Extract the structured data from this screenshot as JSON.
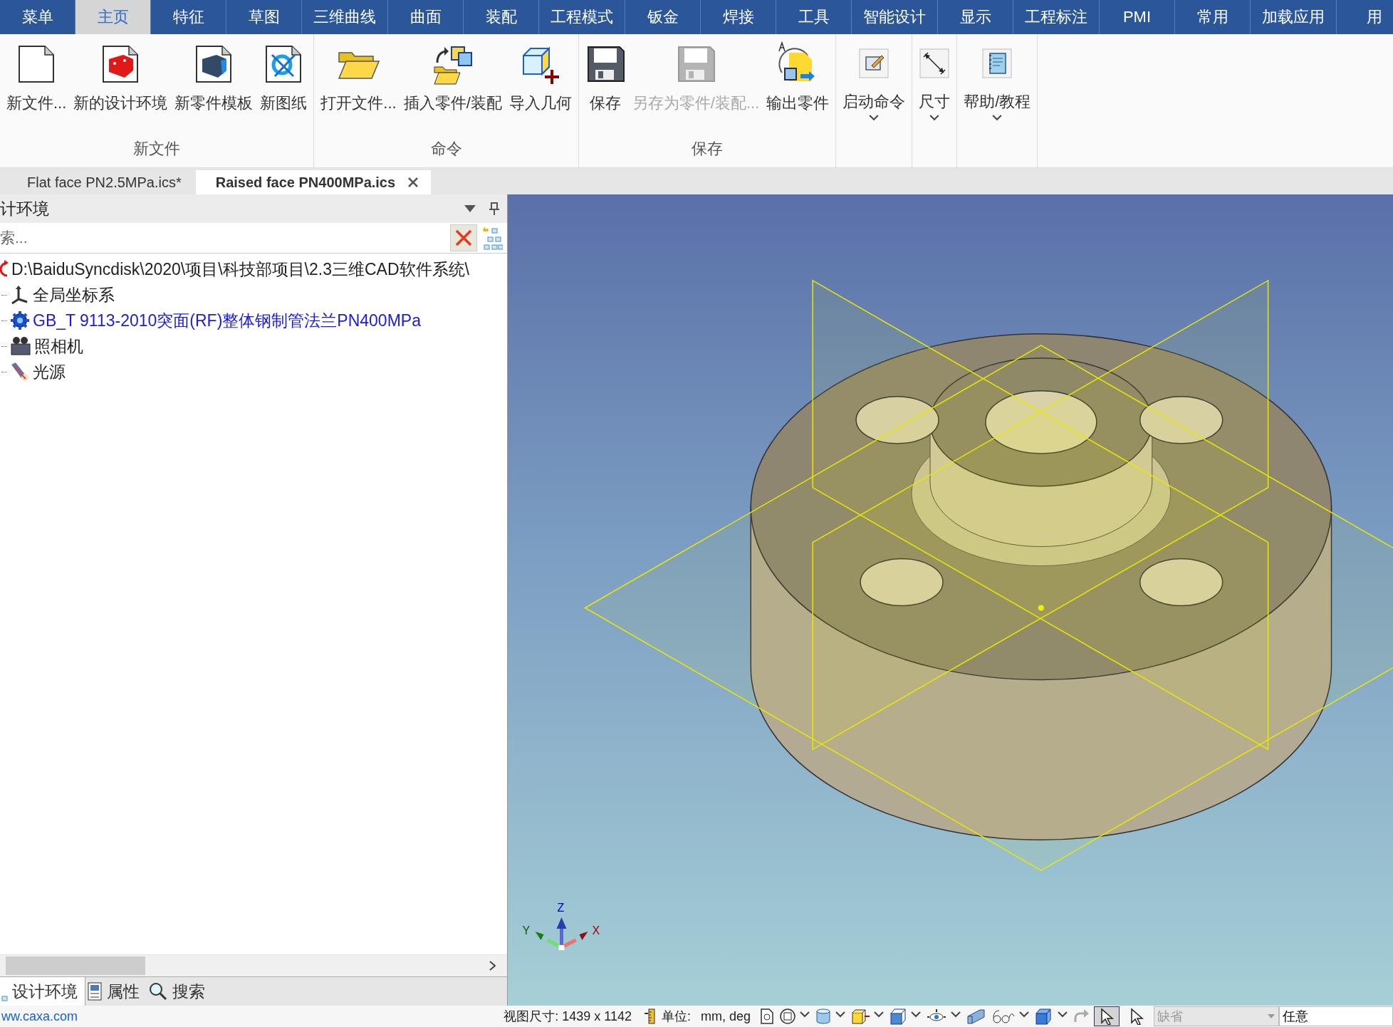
{
  "menu_tabs": [
    {
      "label": "菜单",
      "selected": false
    },
    {
      "label": "主页",
      "selected": true
    },
    {
      "label": "特征",
      "selected": false
    },
    {
      "label": "草图",
      "selected": false
    },
    {
      "label": "三维曲线",
      "selected": false
    },
    {
      "label": "曲面",
      "selected": false
    },
    {
      "label": "装配",
      "selected": false
    },
    {
      "label": "工程模式",
      "selected": false
    },
    {
      "label": "钣金",
      "selected": false
    },
    {
      "label": "焊接",
      "selected": false
    },
    {
      "label": "工具",
      "selected": false
    },
    {
      "label": "智能设计",
      "selected": false
    },
    {
      "label": "显示",
      "selected": false
    },
    {
      "label": "工程标注",
      "selected": false
    },
    {
      "label": "PMI",
      "selected": false
    },
    {
      "label": "常用",
      "selected": false
    },
    {
      "label": "加载应用",
      "selected": false
    },
    {
      "label": "用",
      "selected": false
    }
  ],
  "ribbon": {
    "groups": [
      {
        "label": "新文件",
        "buttons": [
          {
            "label": "新文件...",
            "kind": "new-file",
            "disabled": false,
            "dropdown": false
          },
          {
            "label": "新的设计环境",
            "kind": "new-design",
            "disabled": false,
            "dropdown": false
          },
          {
            "label": "新零件模板",
            "kind": "new-part",
            "disabled": false,
            "dropdown": false
          },
          {
            "label": "新图纸",
            "kind": "new-drawing",
            "disabled": false,
            "dropdown": false
          }
        ]
      },
      {
        "label": "命令",
        "buttons": [
          {
            "label": "打开文件...",
            "kind": "open",
            "disabled": false,
            "dropdown": false
          },
          {
            "label": "插入零件/装配",
            "kind": "insert",
            "disabled": false,
            "dropdown": false
          },
          {
            "label": "导入几何",
            "kind": "import",
            "disabled": false,
            "dropdown": false
          }
        ]
      },
      {
        "label": "保存",
        "buttons": [
          {
            "label": "保存",
            "kind": "save",
            "disabled": false,
            "dropdown": false
          },
          {
            "label": "另存为零件/装配...",
            "kind": "save",
            "disabled": true,
            "dropdown": false
          },
          {
            "label": "输出零件",
            "kind": "export",
            "disabled": false,
            "dropdown": false
          }
        ]
      },
      {
        "buttons": [
          {
            "label": "启动命令",
            "kind": "command",
            "disabled": false,
            "dropdown": true
          }
        ]
      },
      {
        "buttons": [
          {
            "label": "尺寸",
            "kind": "dimension",
            "disabled": false,
            "dropdown": true
          }
        ]
      },
      {
        "buttons": [
          {
            "label": "帮助/教程",
            "kind": "help",
            "disabled": false,
            "dropdown": true
          }
        ]
      }
    ]
  },
  "doc_tabs": [
    {
      "label": "Flat face PN2.5MPa.ics*",
      "selected": false
    },
    {
      "label": "Raised face PN400MPa.ics",
      "selected": true
    }
  ],
  "panel": {
    "title": "计环境",
    "search": {
      "placeholder": "索..."
    },
    "tree": [
      {
        "label": "D:\\BaiduSyncdisk\\2020\\项目\\科技部项目\\2.3三维CAD软件系统\\",
        "kind": "root",
        "active": false,
        "children": [
          {
            "label": "全局坐标系",
            "kind": "axes",
            "active": false
          },
          {
            "label": "GB_T 9113-2010突面(RF)整体钢制管法兰PN400MPa",
            "kind": "part",
            "active": true
          },
          {
            "label": "照相机",
            "kind": "camera",
            "active": false
          },
          {
            "label": "光源",
            "kind": "light",
            "active": false
          }
        ]
      }
    ],
    "bottom_tabs": [
      {
        "label": "设计环境",
        "kind": "tree",
        "selected": true
      },
      {
        "label": "属性",
        "kind": "properties",
        "selected": false
      },
      {
        "label": "搜索",
        "kind": "search",
        "selected": false
      }
    ]
  },
  "viewport": {
    "triad": {
      "z": "Z",
      "y": "Y",
      "x": "X"
    }
  },
  "status_bar": {
    "link": "ww.caxa.com",
    "view_size": "视图尺寸: 1439 x 1142",
    "unit_label": "单位:",
    "unit_value": "mm, deg",
    "tools": [
      {
        "kind": "page",
        "dropdown": false
      },
      {
        "kind": "frame",
        "dropdown": true
      },
      {
        "kind": "cylinder",
        "dropdown": true
      },
      {
        "kind": "yellow-box",
        "dropdown": true
      },
      {
        "kind": "wire-cube",
        "dropdown": true
      },
      {
        "kind": "eye",
        "dropdown": true
      },
      {
        "kind": "prism",
        "dropdown": false
      },
      {
        "kind": "glasses",
        "dropdown": true
      },
      {
        "kind": "blue-cube",
        "dropdown": true
      },
      {
        "kind": "redo",
        "dropdown": false
      }
    ],
    "pick_buttons": [
      {
        "selected": true
      },
      {
        "selected": false
      }
    ],
    "filter": {
      "value": "缺省",
      "disabled": true
    },
    "mode": {
      "value": "任意"
    }
  }
}
